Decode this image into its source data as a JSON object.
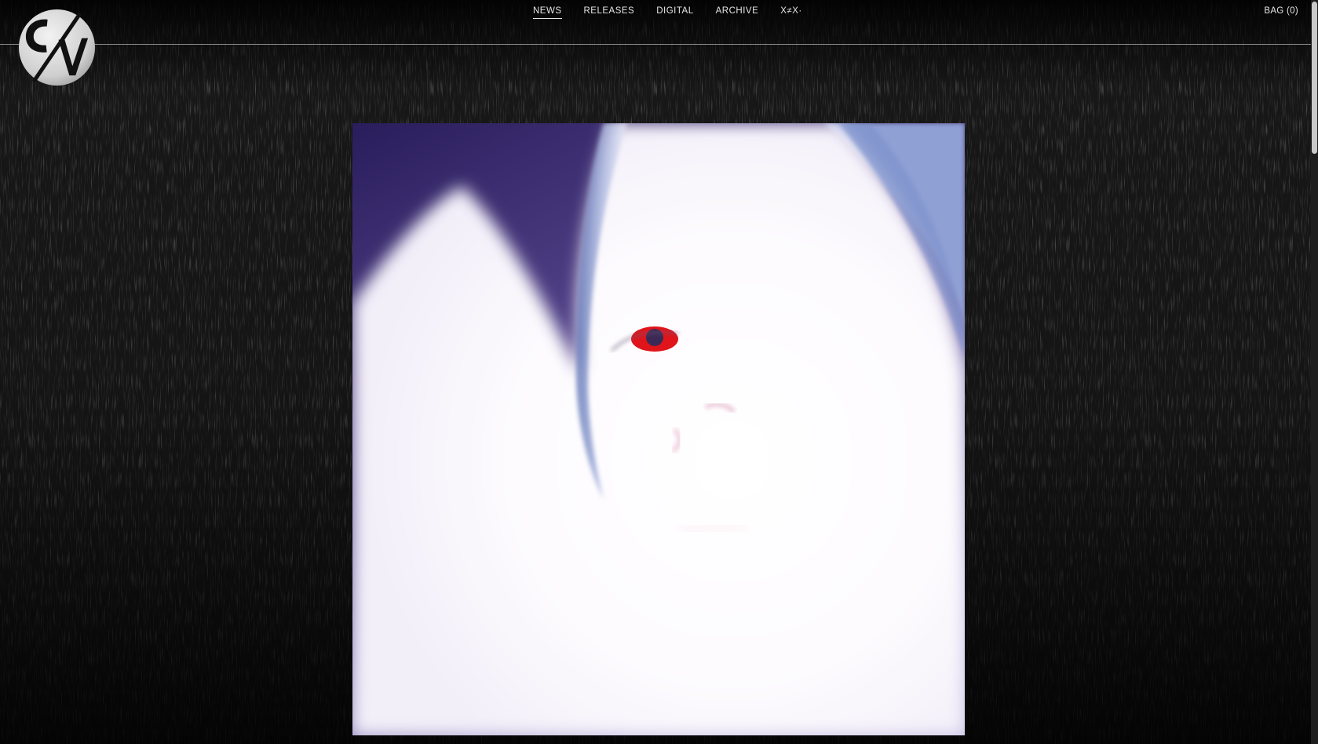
{
  "nav": {
    "items": [
      {
        "label": "NEWS",
        "active": true
      },
      {
        "label": "RELEASES",
        "active": false
      },
      {
        "label": "DIGITAL",
        "active": false
      },
      {
        "label": "ARCHIVE",
        "active": false
      },
      {
        "label": "X≠X·",
        "active": false
      }
    ]
  },
  "bag": {
    "label": "BAG (0)"
  },
  "logo": {
    "name": "cv-logo"
  },
  "hero": {
    "subject": "portrait-photo"
  },
  "colors": {
    "background": "#1b1b1b",
    "text": "#e6e6e6",
    "accent_eye": "#e0141b"
  }
}
